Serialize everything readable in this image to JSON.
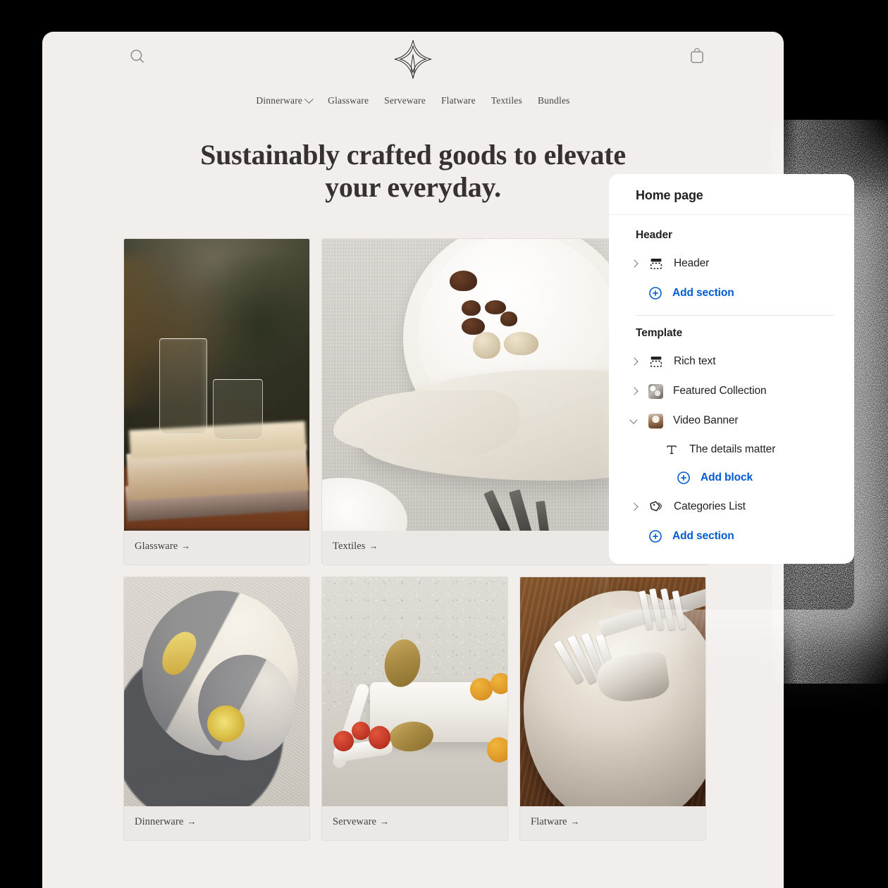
{
  "storefront": {
    "topbar": {
      "search_icon": "search-icon",
      "logo_icon": "brand-star-logo",
      "cart_icon": "shopping-bag-icon"
    },
    "nav": [
      {
        "label": "Dinnerware",
        "has_caret": true
      },
      {
        "label": "Glassware",
        "has_caret": false
      },
      {
        "label": "Serveware",
        "has_caret": false
      },
      {
        "label": "Flatware",
        "has_caret": false
      },
      {
        "label": "Textiles",
        "has_caret": false
      },
      {
        "label": "Bundles",
        "has_caret": false
      }
    ],
    "headline": "Sustainably crafted goods to elevate your everyday.",
    "cards": [
      {
        "label": "Glassware",
        "arrow": "→"
      },
      {
        "label": "Textiles",
        "arrow": "→"
      },
      {
        "label": "Dinnerware",
        "arrow": "→"
      },
      {
        "label": "Serveware",
        "arrow": "→"
      },
      {
        "label": "Flatware",
        "arrow": "→"
      }
    ]
  },
  "panel": {
    "title": "Home page",
    "accent_color": "#005bd3",
    "groups": [
      {
        "title": "Header",
        "rows": [
          {
            "label": "Header",
            "icon": "section-icon",
            "chevron": "right"
          }
        ],
        "add_label": "Add section"
      },
      {
        "title": "Template",
        "rows": [
          {
            "label": "Rich text",
            "icon": "section-icon",
            "chevron": "right"
          },
          {
            "label": "Featured Collection",
            "icon": "image-thumbnail",
            "chevron": "right"
          },
          {
            "label": "Video Banner",
            "icon": "image-thumbnail",
            "chevron": "down"
          }
        ],
        "blocks": [
          {
            "label": "The details matter",
            "icon": "text-block-icon"
          }
        ],
        "add_block_label": "Add block",
        "categories_row": {
          "label": "Categories List",
          "icon": "tag-icon",
          "chevron": "right"
        },
        "add_label": "Add section"
      }
    ]
  }
}
